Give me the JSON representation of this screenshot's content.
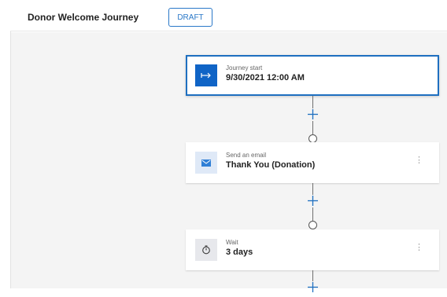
{
  "header": {
    "title": "Donor Welcome Journey",
    "status_badge": "DRAFT"
  },
  "journey": {
    "tiles": [
      {
        "type": "start",
        "label": "Journey start",
        "value": "9/30/2021 12:00 AM",
        "icon": "arrow-right-bar-icon"
      },
      {
        "type": "email",
        "label": "Send an email",
        "value": "Thank You (Donation)",
        "icon": "envelope-icon"
      },
      {
        "type": "wait",
        "label": "Wait",
        "value": "3 days",
        "icon": "timer-icon"
      }
    ],
    "more_glyph": "⋮"
  },
  "colors": {
    "accent": "#1064c6",
    "canvas": "#f4f4f4",
    "connector": "#6f6f6f"
  }
}
